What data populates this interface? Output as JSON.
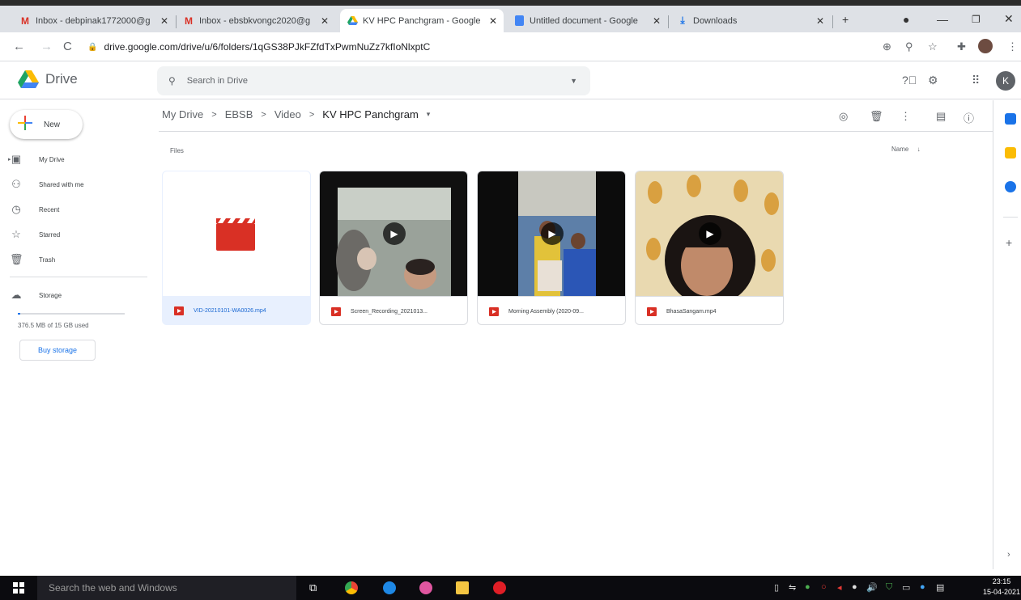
{
  "browser": {
    "tabs": [
      {
        "title": "Inbox - debpinak1772000@g",
        "icon": "gmail-icon"
      },
      {
        "title": "Inbox - ebsbkvongc2020@g",
        "icon": "gmail-icon"
      },
      {
        "title": "KV HPC Panchgram - Google",
        "icon": "drive-icon",
        "active": true
      },
      {
        "title": "Untitled document - Google",
        "icon": "docs-icon"
      },
      {
        "title": "Downloads",
        "icon": "download-icon"
      }
    ],
    "new_tab": "+",
    "url": "drive.google.com/drive/u/6/folders/1qGS38PJkFZfdTxPwmNuZz7kfIoNlxptC"
  },
  "drive": {
    "logo_text": "Drive",
    "search_placeholder": "Search in Drive",
    "avatar_letter": "K",
    "new_label": "New",
    "nav": [
      {
        "label": "My Drive",
        "icon": "my-drive-icon"
      },
      {
        "label": "Shared with me",
        "icon": "shared-icon"
      },
      {
        "label": "Recent",
        "icon": "clock-icon"
      },
      {
        "label": "Starred",
        "icon": "star-icon"
      },
      {
        "label": "Trash",
        "icon": "trash-icon"
      }
    ],
    "storage_label": "Storage",
    "storage_used": "376.5 MB of 15 GB used",
    "storage_fraction": 0.025,
    "buy_storage": "Buy storage",
    "breadcrumb": [
      "My Drive",
      "EBSB",
      "Video",
      "KV HPC Panchgram"
    ],
    "files_label": "Files",
    "sort_label": "Name",
    "files": [
      {
        "name": "VID-20210101-WA0026.mp4",
        "selected": true,
        "thumb": "video-placeholder"
      },
      {
        "name": "Screen_Recording_2021013...",
        "thumb": "video"
      },
      {
        "name": "Morning Assembly (2020-09...",
        "thumb": "video"
      },
      {
        "name": "BhasaSangam.mp4",
        "thumb": "video"
      }
    ]
  },
  "taskbar": {
    "search_placeholder": "Search the web and Windows",
    "time": "23:15",
    "date": "15-04-2021"
  },
  "colors": {
    "accent": "#1a73e8",
    "video_red": "#d93025",
    "tab_bar": "#dee1e6"
  }
}
